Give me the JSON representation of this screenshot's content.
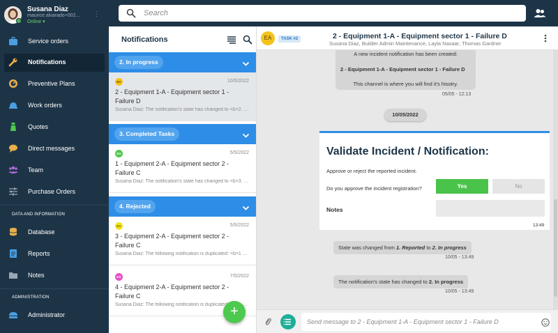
{
  "user": {
    "name": "Susana Diaz",
    "email": "maurice.alvarado+002...",
    "status": "Online ▾"
  },
  "search": {
    "placeholder": "Search"
  },
  "sidebar": {
    "items": [
      {
        "label": "Service orders",
        "icon": "briefcase-icon",
        "color": "#4a9fe3"
      },
      {
        "label": "Notifications",
        "icon": "wrench-icon",
        "color": "#f2b33d",
        "active": true
      },
      {
        "label": "Preventive Plans",
        "icon": "gauge-icon",
        "color": "#e8b04a"
      },
      {
        "label": "Work orders",
        "icon": "hardhat-icon",
        "color": "#4a9fe3"
      },
      {
        "label": "Quotes",
        "icon": "flask-icon",
        "color": "#4dc94f"
      },
      {
        "label": "Direct messages",
        "icon": "chat-bubble-icon",
        "color": "#e8b04a"
      },
      {
        "label": "Team",
        "icon": "team-icon",
        "color": "#b06ad8"
      },
      {
        "label": "Purchase Orders",
        "icon": "sliders-icon",
        "color": "#9aa8b5"
      }
    ],
    "data_section_title": "DATA AND INFORMATION",
    "data_items": [
      {
        "label": "Database",
        "icon": "database-icon",
        "color": "#e8b04a"
      },
      {
        "label": "Reports",
        "icon": "report-icon",
        "color": "#4a9fe3"
      },
      {
        "label": "Notes",
        "icon": "folder-icon",
        "color": "#9aa8b5"
      }
    ],
    "admin_section_title": "ADMINISTRATION",
    "admin_items": [
      {
        "label": "Administrator",
        "icon": "admin-icon",
        "color": "#4a9fe3"
      }
    ]
  },
  "notifications": {
    "title": "Notifications",
    "groups": [
      {
        "label": "2. In progress",
        "items": [
          {
            "date": "10/5/2022",
            "title": "2 - Equipment 1-A - Equipment sector 1 - Failure D",
            "preview": "Susana Diaz: The notification's state has changed to <b>2. In progress</b>",
            "badge": "EA",
            "badge_color": "#f3c31c",
            "selected": true
          }
        ]
      },
      {
        "label": "3. Completed Tasks",
        "items": [
          {
            "date": "5/5/2022",
            "title": "1 - Equipment 2-A - Equipment sector 2 - Failure C",
            "preview": "Susana Diaz: The notification's state has changed to <b>3. Completed Tasks</b>",
            "badge": "EA",
            "badge_color": "#4dc94f"
          }
        ]
      },
      {
        "label": "4. Rejected",
        "items": [
          {
            "date": "5/5/2022",
            "title": "3 - Equipment 2-A - Equipment sector 2 - Failure C",
            "preview": "Susana Diaz: The following notification is duplicated: <b>1 - Equipment</b>",
            "badge": "EA",
            "badge_color": "#f3e21c"
          },
          {
            "date": "7/5/2022",
            "title": "4 - Equipment 2-A - Equipment sector 2 - Failure C",
            "preview": "Susana Diaz: The following notification is duplicated: <b>1 - Equipment</b>",
            "badge": "EA",
            "badge_color": "#e84fc4"
          }
        ]
      }
    ],
    "fab_label": "+"
  },
  "chat": {
    "avatar": "EA",
    "task_badge": "TASK #2",
    "title": "2 - Equipment 1-A - Equipment sector 1 - Failure D",
    "members": "Susana Diaz, Builder Admin Maintenance, Layla Nasaar, Thomas Gardner",
    "system_message": {
      "line1": "A new incident notification has been created:",
      "line2": "2 -  Equipment 1-A - Equipment sector 1 - Failure D",
      "line3": "This channel is where you will find it's hisotry.",
      "time": "05/05 - 12:13"
    },
    "date_separator": "10/05/2022",
    "card": {
      "title": "Validate Incident / Notification:",
      "description": "Approve or reject the reported incident.",
      "question": "Do you approve the incident registration?",
      "yes_label": "Yes",
      "no_label": "No",
      "notes_label": "Notes",
      "time": "13:49"
    },
    "state_change": {
      "prefix": "State was changed from ",
      "from": "1. Reported",
      "middle": " to ",
      "to": "2. In progress",
      "time": "10/05 - 13:49"
    },
    "state_notice": {
      "prefix": "The notification's state has changed to ",
      "state": "2. In progress",
      "time": "10/05 - 13:49"
    },
    "composer_placeholder": "Send message to 2 - Equipment 1-A - Equipment sector 1 - Failure D"
  }
}
